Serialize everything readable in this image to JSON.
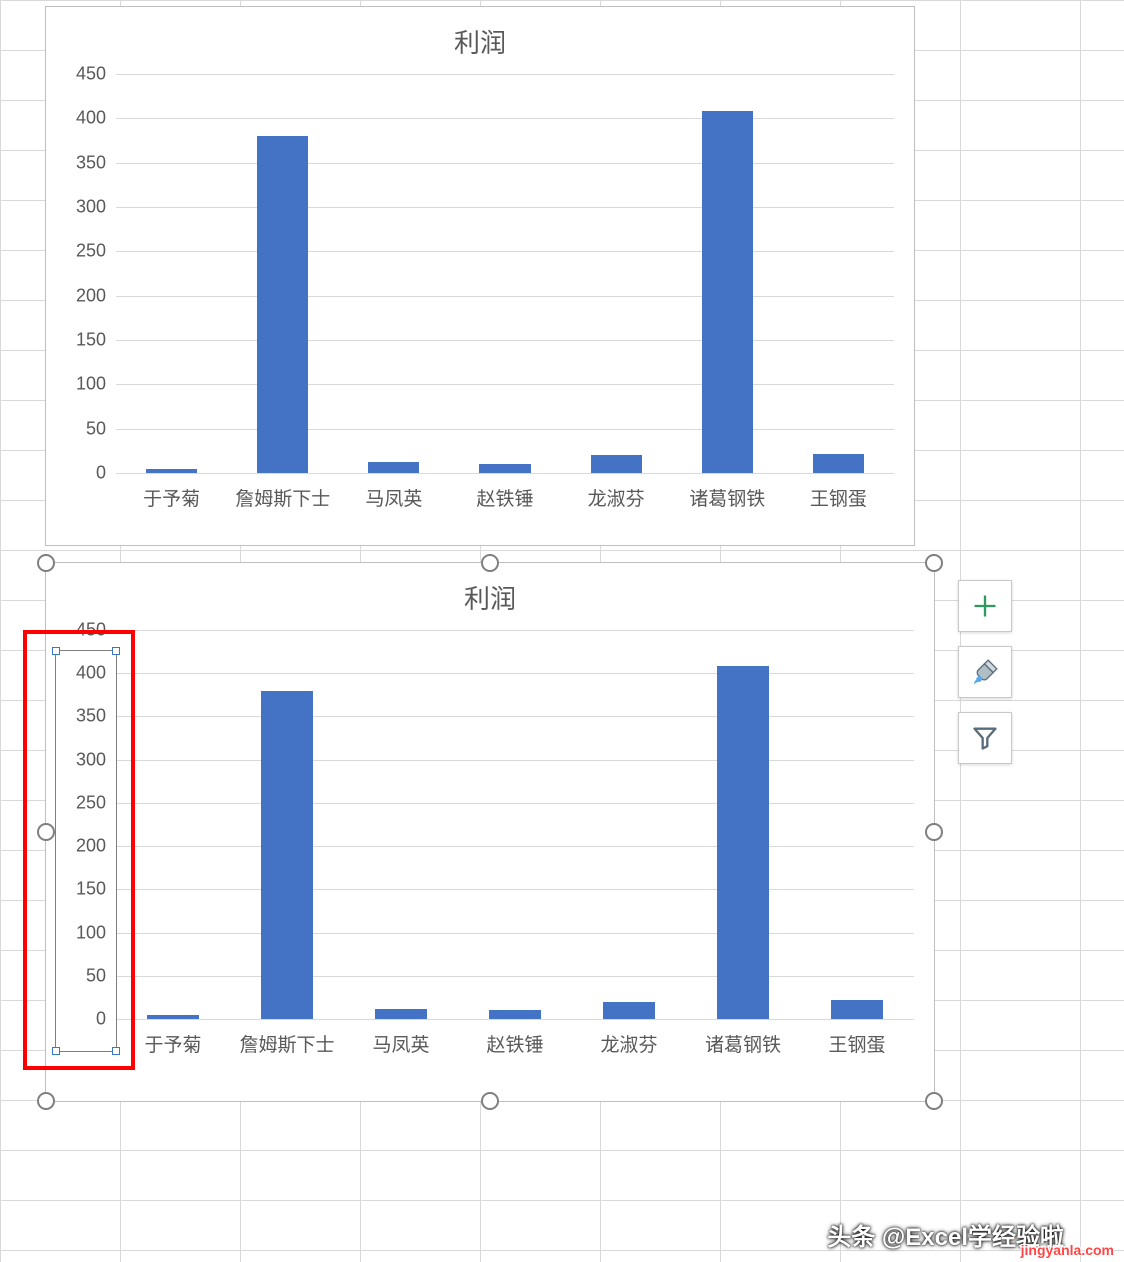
{
  "chart_data": [
    {
      "type": "bar",
      "title": "利润",
      "categories": [
        "于予菊",
        "詹姆斯下士",
        "马凤英",
        "赵铁锤",
        "龙淑芬",
        "诸葛钢铁",
        "王钢蛋"
      ],
      "values": [
        5,
        380,
        12,
        10,
        20,
        408,
        22
      ],
      "xlabel": "",
      "ylabel": "",
      "ylim": [
        0,
        450
      ],
      "ytick_step": 50,
      "bar_color": "#4472c4",
      "yticks": [
        0,
        50,
        100,
        150,
        200,
        250,
        300,
        350,
        400,
        450
      ]
    },
    {
      "type": "bar",
      "title": "利润",
      "categories": [
        "于予菊",
        "詹姆斯下士",
        "马凤英",
        "赵铁锤",
        "龙淑芬",
        "诸葛钢铁",
        "王钢蛋"
      ],
      "values": [
        5,
        380,
        12,
        10,
        20,
        408,
        22
      ],
      "xlabel": "",
      "ylabel": "",
      "ylim": [
        0,
        450
      ],
      "ytick_step": 50,
      "bar_color": "#4472c4",
      "selected": true,
      "axis_selected": true,
      "yticks": [
        0,
        50,
        100,
        150,
        200,
        250,
        300,
        350,
        400,
        450
      ]
    }
  ],
  "side_tools": {
    "add_element": "Chart Elements",
    "style": "Chart Styles",
    "filter": "Chart Filters"
  },
  "watermark": {
    "main": "头条 @Excel学经验啦",
    "site": "jingyanla.com"
  }
}
